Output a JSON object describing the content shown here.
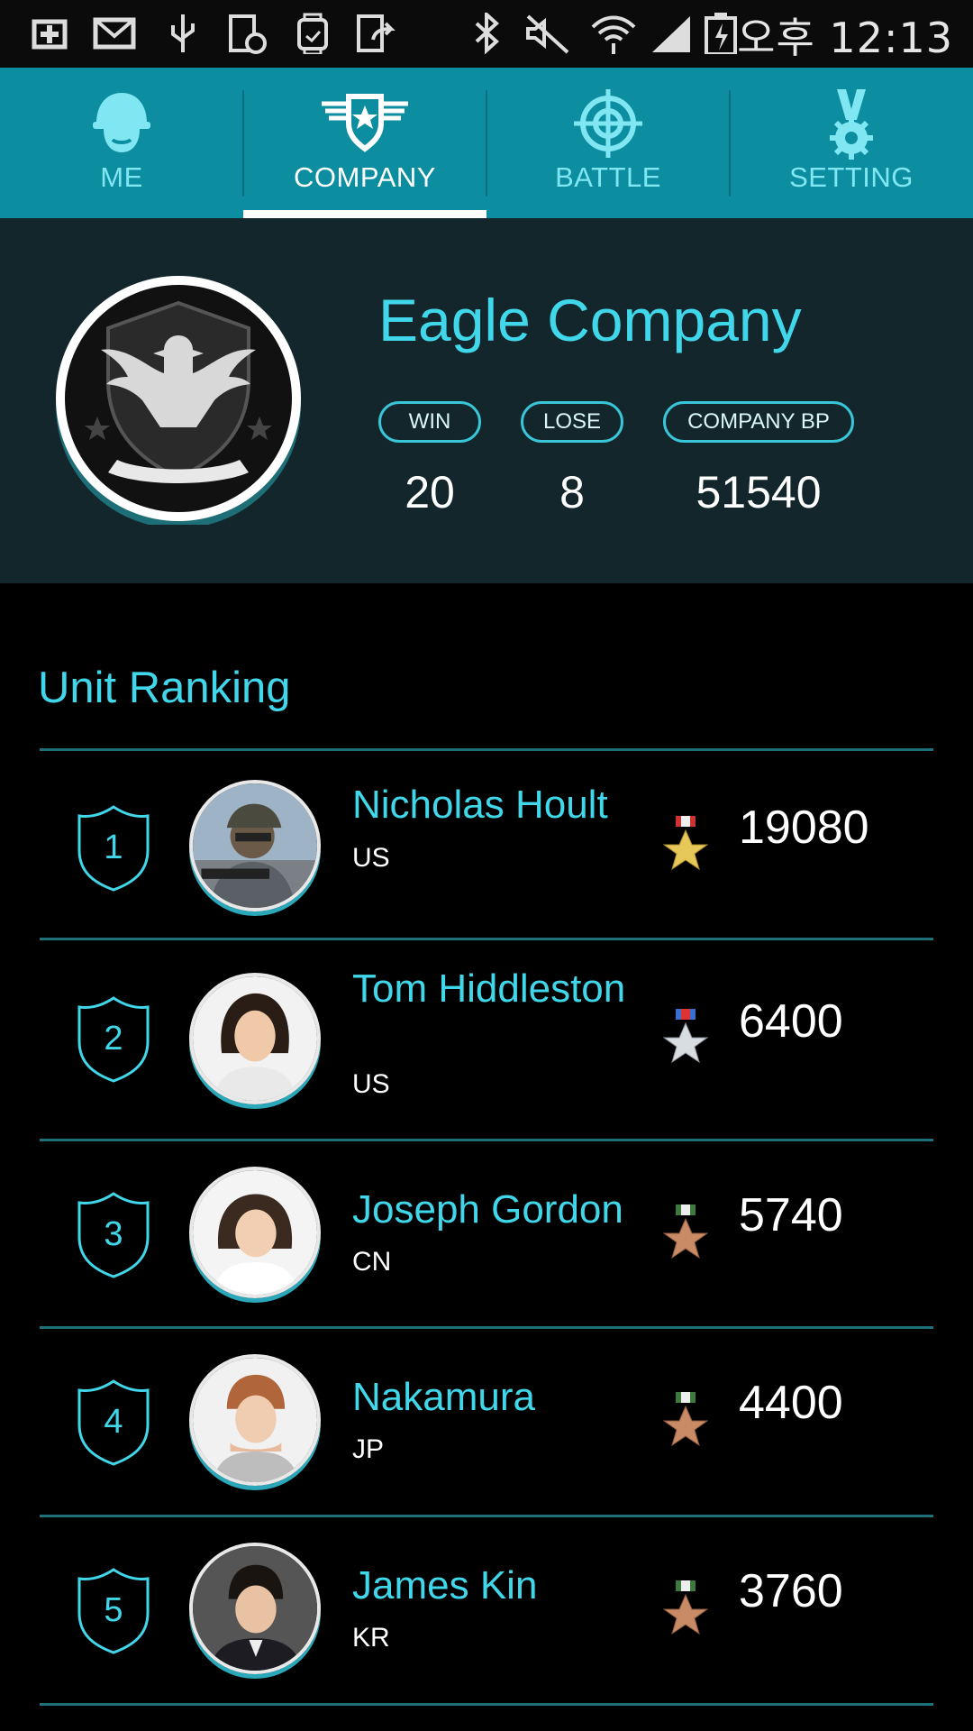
{
  "status_bar": {
    "icons": [
      "plus-icon",
      "mail-icon",
      "usb-icon",
      "alarm-icon",
      "watch-icon",
      "share-icon",
      "bluetooth-icon",
      "mute-icon",
      "wifi-icon",
      "signal-icon",
      "battery-icon"
    ],
    "time": "오후 12:13"
  },
  "tabs": [
    {
      "label": "ME",
      "icon": "helmet-icon"
    },
    {
      "label": "COMPANY",
      "icon": "wing-star-icon"
    },
    {
      "label": "BATTLE",
      "icon": "crosshair-icon"
    },
    {
      "label": "SETTING",
      "icon": "medal-gear-icon"
    }
  ],
  "active_tab": "COMPANY",
  "company": {
    "name": "Eagle Company",
    "stats": [
      {
        "label": "WIN",
        "value": "20"
      },
      {
        "label": "LOSE",
        "value": "8"
      },
      {
        "label": "COMPANY BP",
        "value": "51540"
      }
    ]
  },
  "ranking": {
    "title": "Unit Ranking",
    "rows": [
      {
        "rank": "1",
        "name": "Nicholas Hoult",
        "country": "US",
        "medal": "gold",
        "score": "19080"
      },
      {
        "rank": "2",
        "name": "Tom Hiddleston",
        "country": "US",
        "medal": "silver",
        "score": "6400"
      },
      {
        "rank": "3",
        "name": "Joseph Gordon",
        "country": "CN",
        "medal": "bronze",
        "score": "5740"
      },
      {
        "rank": "4",
        "name": "Nakamura",
        "country": "JP",
        "medal": "bronze",
        "score": "4400"
      },
      {
        "rank": "5",
        "name": "James Kin",
        "country": "KR",
        "medal": "bronze",
        "score": "3760"
      }
    ]
  },
  "colors": {
    "accent": "#41d7ea",
    "tab_bar": "#0d8ea0",
    "panel": "#12262b",
    "divider": "#1f6f7a"
  }
}
